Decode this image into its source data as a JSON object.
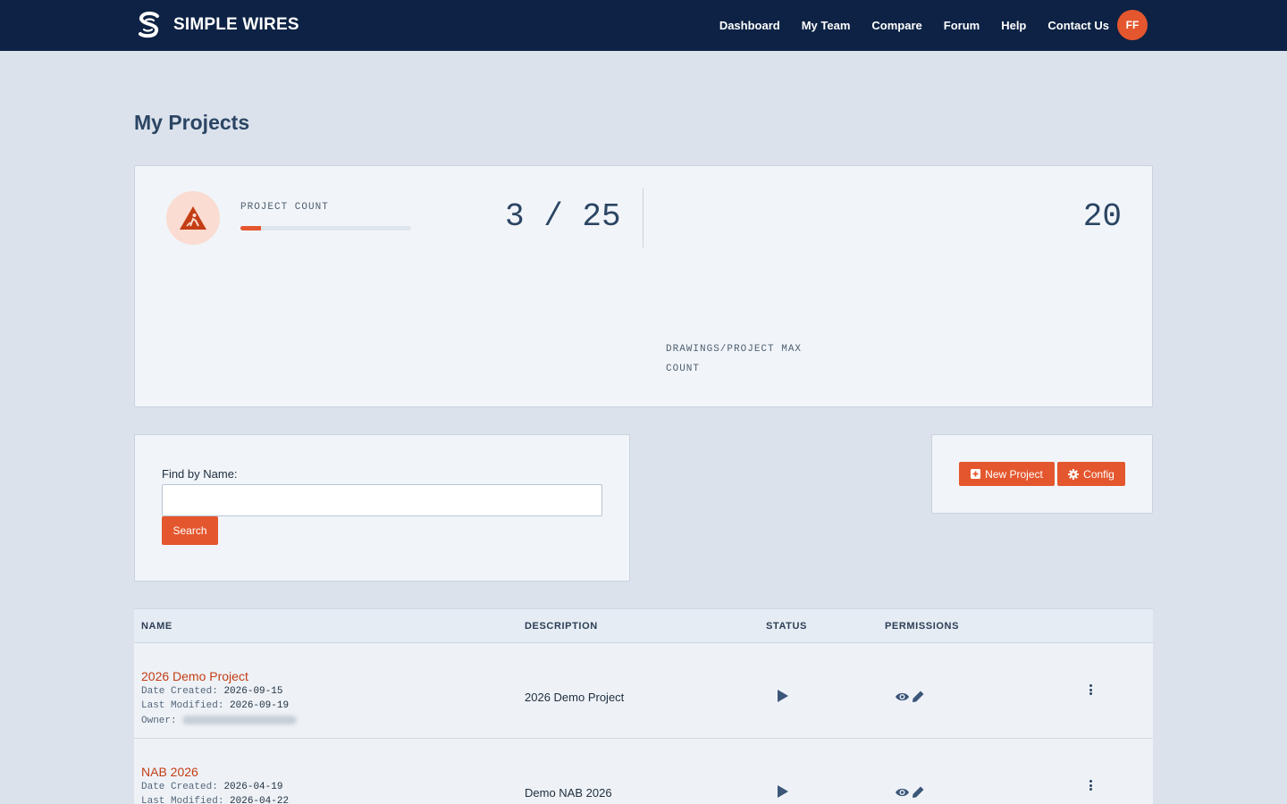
{
  "header": {
    "brand": "SIMPLE WIRES",
    "nav": [
      "Dashboard",
      "My Team",
      "Compare",
      "Forum",
      "Help",
      "Contact Us"
    ],
    "avatar_initials": "FF"
  },
  "page": {
    "title": "My Projects"
  },
  "stats": {
    "project_count_label": "PROJECT COUNT",
    "project_count_value": "3 / 25",
    "project_count_progress_fraction": 0.12,
    "drawings_max_label": "DRAWINGS/PROJECT MAX COUNT",
    "drawings_max_value": "20",
    "icon": "construction-warning-icon"
  },
  "search": {
    "label": "Find by Name:",
    "value": "",
    "placeholder": "",
    "button": "Search"
  },
  "actions": {
    "new_project": "New Project",
    "config": "Config"
  },
  "table": {
    "headers": [
      "NAME",
      "DESCRIPTION",
      "STATUS",
      "PERMISSIONS"
    ],
    "meta_labels": {
      "created": "Date Created:",
      "modified": "Last Modified:",
      "owner": "Owner:"
    },
    "rows": [
      {
        "name": "2026 Demo Project",
        "created": "2026-09-15",
        "modified": "2026-09-19",
        "description": "2026 Demo Project",
        "status_icon": "play-icon",
        "permission_icons": [
          "eye-icon",
          "pencil-icon"
        ]
      },
      {
        "name": "NAB 2026",
        "created": "2026-04-19",
        "modified": "2026-04-22",
        "description": "Demo NAB 2026",
        "status_icon": "play-icon",
        "permission_icons": [
          "eye-icon",
          "pencil-icon"
        ]
      }
    ]
  },
  "colors": {
    "navbar": "#0d2244",
    "accent": "#e4572e",
    "background": "#dbe2ec",
    "card": "#f1f5f9"
  }
}
